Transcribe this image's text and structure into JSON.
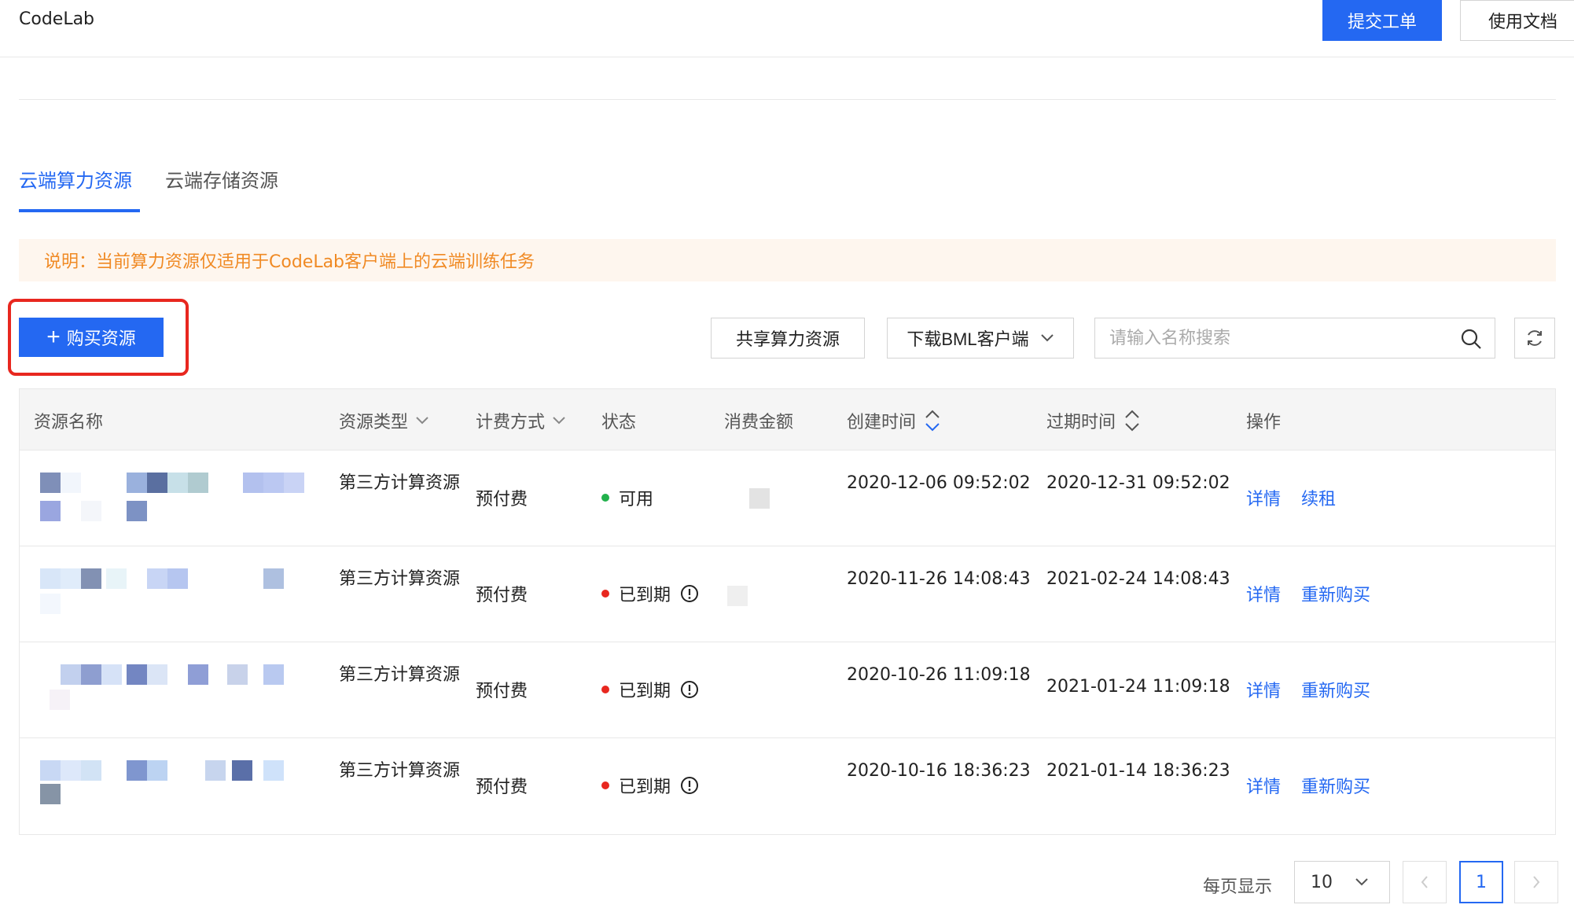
{
  "app": {
    "title": "CodeLab"
  },
  "header": {
    "submit_ticket": "提交工单",
    "docs": "使用文档"
  },
  "tabs": [
    {
      "label": "云端算力资源",
      "active": true
    },
    {
      "label": "云端存储资源",
      "active": false
    }
  ],
  "notice": "说明：当前算力资源仅适用于CodeLab客户端上的云端训练任务",
  "toolbar": {
    "buy_label": "购买资源",
    "share_label": "共享算力资源",
    "download_label": "下载BML客户端",
    "search_placeholder": "请输入名称搜索"
  },
  "table": {
    "columns": [
      "资源名称",
      "资源类型",
      "计费方式",
      "状态",
      "消费金额",
      "创建时间",
      "过期时间",
      "操作"
    ],
    "rows": [
      {
        "type": "第三方计算资源",
        "billing": "预付费",
        "status": "可用",
        "status_color": "#22b14c",
        "warn": false,
        "created": "2020-12-06 09:52:02",
        "expires": "2020-12-31 09:52:02",
        "actions": [
          "详情",
          "续租"
        ]
      },
      {
        "type": "第三方计算资源",
        "billing": "预付费",
        "status": "已到期",
        "status_color": "#e8271f",
        "warn": true,
        "created": "2020-11-26 14:08:43",
        "expires": "2021-02-24 14:08:43",
        "actions": [
          "详情",
          "重新购买"
        ]
      },
      {
        "type": "第三方计算资源",
        "billing": "预付费",
        "status": "已到期",
        "status_color": "#e8271f",
        "warn": true,
        "created": "2020-10-26 11:09:18",
        "expires": "2021-01-24 11:09:18",
        "actions": [
          "详情",
          "重新购买"
        ]
      },
      {
        "type": "第三方计算资源",
        "billing": "预付费",
        "status": "已到期",
        "status_color": "#e8271f",
        "warn": true,
        "created": "2020-10-16 18:36:23",
        "expires": "2021-01-14 18:36:23",
        "actions": [
          "详情",
          "重新购买"
        ]
      }
    ]
  },
  "pagination": {
    "per_page_label": "每页显示",
    "per_page_value": "10",
    "current_page": "1"
  },
  "colors": {
    "primary": "#2468f2",
    "notice_text": "#f08a24",
    "notice_bg": "#fef6ee",
    "highlight": "#e8271f"
  }
}
